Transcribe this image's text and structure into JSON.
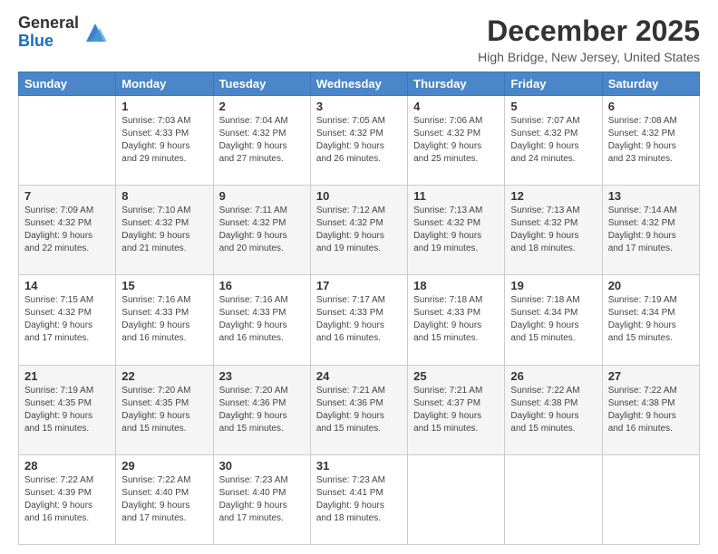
{
  "logo": {
    "general": "General",
    "blue": "Blue"
  },
  "header": {
    "title": "December 2025",
    "subtitle": "High Bridge, New Jersey, United States"
  },
  "weekdays": [
    "Sunday",
    "Monday",
    "Tuesday",
    "Wednesday",
    "Thursday",
    "Friday",
    "Saturday"
  ],
  "weeks": [
    [
      {
        "day": "",
        "info": ""
      },
      {
        "day": "1",
        "info": "Sunrise: 7:03 AM\nSunset: 4:33 PM\nDaylight: 9 hours\nand 29 minutes."
      },
      {
        "day": "2",
        "info": "Sunrise: 7:04 AM\nSunset: 4:32 PM\nDaylight: 9 hours\nand 27 minutes."
      },
      {
        "day": "3",
        "info": "Sunrise: 7:05 AM\nSunset: 4:32 PM\nDaylight: 9 hours\nand 26 minutes."
      },
      {
        "day": "4",
        "info": "Sunrise: 7:06 AM\nSunset: 4:32 PM\nDaylight: 9 hours\nand 25 minutes."
      },
      {
        "day": "5",
        "info": "Sunrise: 7:07 AM\nSunset: 4:32 PM\nDaylight: 9 hours\nand 24 minutes."
      },
      {
        "day": "6",
        "info": "Sunrise: 7:08 AM\nSunset: 4:32 PM\nDaylight: 9 hours\nand 23 minutes."
      }
    ],
    [
      {
        "day": "7",
        "info": "Sunrise: 7:09 AM\nSunset: 4:32 PM\nDaylight: 9 hours\nand 22 minutes."
      },
      {
        "day": "8",
        "info": "Sunrise: 7:10 AM\nSunset: 4:32 PM\nDaylight: 9 hours\nand 21 minutes."
      },
      {
        "day": "9",
        "info": "Sunrise: 7:11 AM\nSunset: 4:32 PM\nDaylight: 9 hours\nand 20 minutes."
      },
      {
        "day": "10",
        "info": "Sunrise: 7:12 AM\nSunset: 4:32 PM\nDaylight: 9 hours\nand 19 minutes."
      },
      {
        "day": "11",
        "info": "Sunrise: 7:13 AM\nSunset: 4:32 PM\nDaylight: 9 hours\nand 19 minutes."
      },
      {
        "day": "12",
        "info": "Sunrise: 7:13 AM\nSunset: 4:32 PM\nDaylight: 9 hours\nand 18 minutes."
      },
      {
        "day": "13",
        "info": "Sunrise: 7:14 AM\nSunset: 4:32 PM\nDaylight: 9 hours\nand 17 minutes."
      }
    ],
    [
      {
        "day": "14",
        "info": "Sunrise: 7:15 AM\nSunset: 4:32 PM\nDaylight: 9 hours\nand 17 minutes."
      },
      {
        "day": "15",
        "info": "Sunrise: 7:16 AM\nSunset: 4:33 PM\nDaylight: 9 hours\nand 16 minutes."
      },
      {
        "day": "16",
        "info": "Sunrise: 7:16 AM\nSunset: 4:33 PM\nDaylight: 9 hours\nand 16 minutes."
      },
      {
        "day": "17",
        "info": "Sunrise: 7:17 AM\nSunset: 4:33 PM\nDaylight: 9 hours\nand 16 minutes."
      },
      {
        "day": "18",
        "info": "Sunrise: 7:18 AM\nSunset: 4:33 PM\nDaylight: 9 hours\nand 15 minutes."
      },
      {
        "day": "19",
        "info": "Sunrise: 7:18 AM\nSunset: 4:34 PM\nDaylight: 9 hours\nand 15 minutes."
      },
      {
        "day": "20",
        "info": "Sunrise: 7:19 AM\nSunset: 4:34 PM\nDaylight: 9 hours\nand 15 minutes."
      }
    ],
    [
      {
        "day": "21",
        "info": "Sunrise: 7:19 AM\nSunset: 4:35 PM\nDaylight: 9 hours\nand 15 minutes."
      },
      {
        "day": "22",
        "info": "Sunrise: 7:20 AM\nSunset: 4:35 PM\nDaylight: 9 hours\nand 15 minutes."
      },
      {
        "day": "23",
        "info": "Sunrise: 7:20 AM\nSunset: 4:36 PM\nDaylight: 9 hours\nand 15 minutes."
      },
      {
        "day": "24",
        "info": "Sunrise: 7:21 AM\nSunset: 4:36 PM\nDaylight: 9 hours\nand 15 minutes."
      },
      {
        "day": "25",
        "info": "Sunrise: 7:21 AM\nSunset: 4:37 PM\nDaylight: 9 hours\nand 15 minutes."
      },
      {
        "day": "26",
        "info": "Sunrise: 7:22 AM\nSunset: 4:38 PM\nDaylight: 9 hours\nand 15 minutes."
      },
      {
        "day": "27",
        "info": "Sunrise: 7:22 AM\nSunset: 4:38 PM\nDaylight: 9 hours\nand 16 minutes."
      }
    ],
    [
      {
        "day": "28",
        "info": "Sunrise: 7:22 AM\nSunset: 4:39 PM\nDaylight: 9 hours\nand 16 minutes."
      },
      {
        "day": "29",
        "info": "Sunrise: 7:22 AM\nSunset: 4:40 PM\nDaylight: 9 hours\nand 17 minutes."
      },
      {
        "day": "30",
        "info": "Sunrise: 7:23 AM\nSunset: 4:40 PM\nDaylight: 9 hours\nand 17 minutes."
      },
      {
        "day": "31",
        "info": "Sunrise: 7:23 AM\nSunset: 4:41 PM\nDaylight: 9 hours\nand 18 minutes."
      },
      {
        "day": "",
        "info": ""
      },
      {
        "day": "",
        "info": ""
      },
      {
        "day": "",
        "info": ""
      }
    ]
  ]
}
